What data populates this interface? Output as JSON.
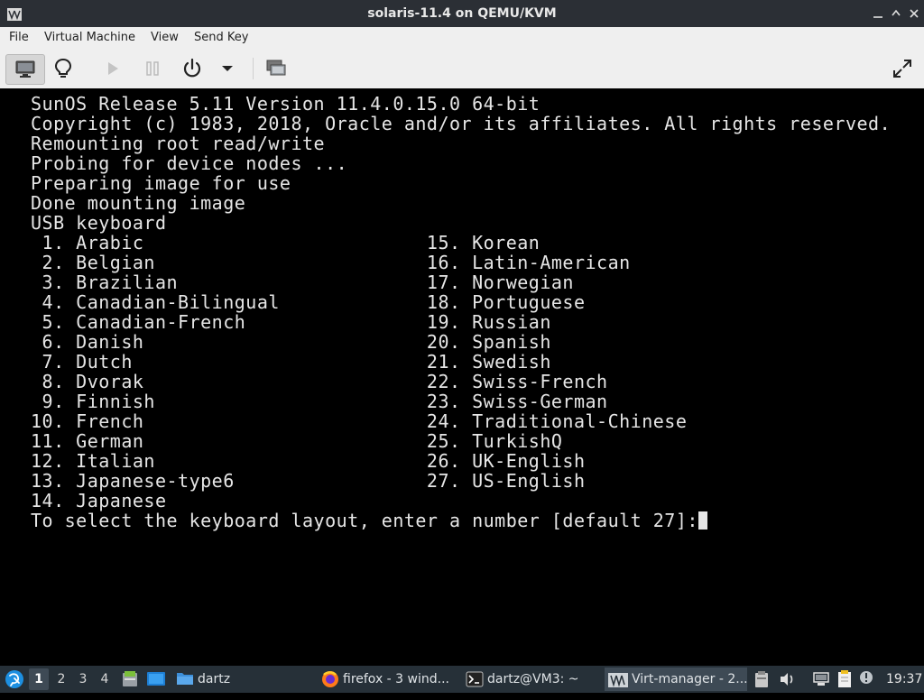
{
  "window": {
    "title": "solaris-11.4 on QEMU/KVM"
  },
  "menubar": {
    "items": [
      {
        "label": "File"
      },
      {
        "label": "Virtual Machine"
      },
      {
        "label": "View"
      },
      {
        "label": "Send Key"
      }
    ]
  },
  "toolbar": {
    "buttons": [
      {
        "name": "console-view",
        "icon": "monitor-icon"
      },
      {
        "name": "details-view",
        "icon": "lightbulb-icon"
      },
      {
        "name": "run",
        "icon": "play-icon"
      },
      {
        "name": "pause",
        "icon": "pause-icon"
      },
      {
        "name": "shutdown",
        "icon": "power-icon"
      },
      {
        "name": "shutdown-menu",
        "icon": "dropdown-arrow-icon"
      },
      {
        "name": "snapshots",
        "icon": "snapshots-icon"
      },
      {
        "name": "fullscreen",
        "icon": "fullscreen-icon"
      }
    ]
  },
  "console": {
    "lines": [
      "SunOS Release 5.11 Version 11.4.0.15.0 64-bit",
      "Copyright (c) 1983, 2018, Oracle and/or its affiliates. All rights reserved.",
      "Remounting root read/write",
      "Probing for device nodes ...",
      "Preparing image for use",
      "Done mounting image",
      "USB keyboard",
      " 1. Arabic                         15. Korean",
      " 2. Belgian                        16. Latin-American",
      " 3. Brazilian                      17. Norwegian",
      " 4. Canadian-Bilingual             18. Portuguese",
      " 5. Canadian-French                19. Russian",
      " 6. Danish                         20. Spanish",
      " 7. Dutch                          21. Swedish",
      " 8. Dvorak                         22. Swiss-French",
      " 9. Finnish                        23. Swiss-German",
      "10. French                         24. Traditional-Chinese",
      "11. German                         25. TurkishQ",
      "12. Italian                        26. UK-English",
      "13. Japanese-type6                 27. US-English",
      "14. Japanese"
    ],
    "prompt": "To select the keyboard layout, enter a number [default 27]:"
  },
  "taskbar": {
    "workspaces": [
      "1",
      "2",
      "3",
      "4"
    ],
    "active_workspace": "1",
    "launchers": [
      {
        "icon": "file-manager-icon"
      },
      {
        "icon": "show-desktop-icon"
      }
    ],
    "folder_label": "dartz",
    "tasks": [
      {
        "icon": "firefox-icon",
        "label": "firefox - 3 wind..."
      },
      {
        "icon": "terminal-icon",
        "label": "dartz@VM3: ~"
      },
      {
        "icon": "virt-manager-icon",
        "label": "Virt-manager - 2..."
      }
    ],
    "clock": "19:37"
  }
}
